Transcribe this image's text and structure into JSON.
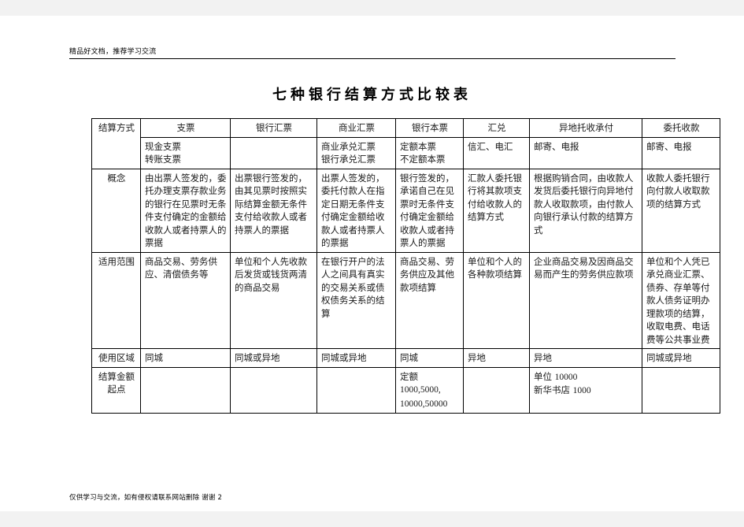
{
  "page": {
    "header_note": "精品好文档，推荐学习交流",
    "footer_note": "仅供学习与交流，如有侵权请联系网站删除 谢谢 2",
    "title": "七种银行结算方式比较表"
  },
  "table": {
    "corner_label": "结算方式",
    "columns": [
      {
        "name": "支票",
        "subtypes": "现金支票\n转账支票"
      },
      {
        "name": "银行汇票",
        "subtypes": ""
      },
      {
        "name": "商业汇票",
        "subtypes": "商业承兑汇票\n银行承兑汇票"
      },
      {
        "name": "银行本票",
        "subtypes": "定额本票\n不定额本票"
      },
      {
        "name": "汇兑",
        "subtypes": "信汇、电汇"
      },
      {
        "name": "异地托收承付",
        "subtypes": "邮寄、电报"
      },
      {
        "name": "委托收款",
        "subtypes": "邮寄、电报"
      }
    ],
    "rows": [
      {
        "label": "概念",
        "cells": [
          "由出票人签发的，委托办理支票存款业务的银行在见票时无条件支付确定的金额给收款人或者持票人的票据",
          "出票银行签发的，由其见票时按照实际结算金额无条件支付给收款人或者持票人的票据",
          "出票人签发的，委托付款人在指定日期无条件支付确定金额给收款人或者持票人的票据",
          "银行签发的，承诺自己在见票时无条件支付确定金额给收款人或者持票人的票据",
          "汇款人委托银行将其款项支付给收款人的结算方式",
          "根据购销合同，由收款人发货后委托银行向异地付款人收取款项，由付款人向银行承认付款的结算方式",
          "收款人委托银行向付款人收取款项的结算方式"
        ]
      },
      {
        "label": "适用范围",
        "cells": [
          "商品交易、劳务供应、清偿债务等",
          "单位和个人先收款后发货或钱货两清的商品交易",
          "在银行开户的法人之间具有真实的交易关系或债权债务关系的结算",
          "商品交易、劳务供应及其他款项结算",
          "单位和个人的各种款项结算",
          "企业商品交易及因商品交易而产生的劳务供应款项",
          "单位和个人凭已承兑商业汇票、债券、存单等付款人债务证明办理款项的结算，收取电费、电话费等公共事业费"
        ]
      },
      {
        "label": "使用区域",
        "cells": [
          "同城",
          "同城或异地",
          "同城或异地",
          "同城",
          "异地",
          "异地",
          "同城或异地"
        ]
      },
      {
        "label": "结算金额起点",
        "cells": [
          "",
          "",
          "",
          "定额\n1000,5000,\n10000,50000",
          "",
          "单位 10000\n新华书店 1000",
          ""
        ]
      }
    ]
  }
}
